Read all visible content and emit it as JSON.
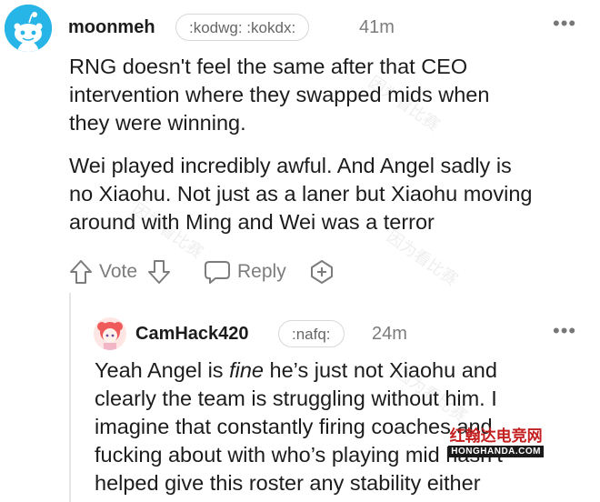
{
  "comment": {
    "username": "moonmeh",
    "flair": ":kodwg: :kokdx:",
    "time": "41m",
    "paragraphs": [
      [
        "RNG doesn't feel the same after that CEO",
        "intervention where they swapped mids when",
        "they were winning."
      ],
      [
        "Wei played incredibly awful. And Angel sadly is",
        "no Xiaohu. Not just as a laner but Xiaohu moving",
        "around with Ming and Wei was a terror"
      ]
    ],
    "actions": {
      "vote_label": "Vote",
      "reply_label": "Reply"
    }
  },
  "reply": {
    "username": "CamHack420",
    "flair": ":nafq:",
    "time": "24m",
    "lines": [
      {
        "before": "Yeah Angel is ",
        "em": "fine",
        "after": " he’s just not Xiaohu and"
      },
      {
        "text": "clearly the team is struggling without him. I"
      },
      {
        "text": "imagine that constantly firing coaches and"
      },
      {
        "text": "fucking about with who’s playing mid hasn’t"
      },
      {
        "text": "helped give this roster any stability either"
      }
    ]
  },
  "more_glyph": "•••",
  "watermark_text": "因为看比赛",
  "site_watermark": {
    "cn": "红翰达电竞网",
    "en": "HONGHANDA.COM"
  },
  "colors": {
    "avatar_blue": "#27b4e6",
    "text": "#1c1c1c",
    "muted": "#7c7c7c"
  }
}
